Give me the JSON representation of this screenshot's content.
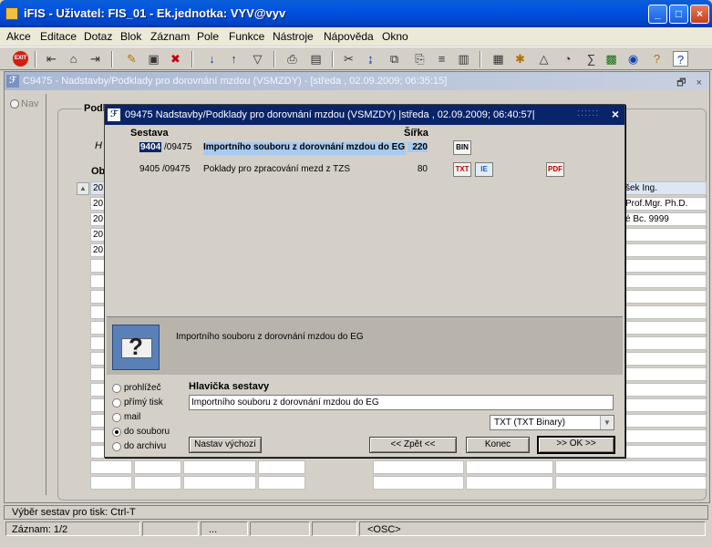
{
  "app": {
    "title": "iFIS - Uživatel: FIS_01 - Ek.jednotka: VYV@vyv",
    "window_buttons": [
      "_",
      "□",
      "×"
    ]
  },
  "menu": [
    "Akce",
    "Editace",
    "Dotaz",
    "Blok",
    "Záznam",
    "Pole",
    "Funkce",
    "Nástroje",
    "Nápověda",
    "Okno"
  ],
  "toolbar": {
    "exit_label": "EXIT",
    "icons": [
      "exit-icon",
      "save-icon",
      "cancel-icon",
      "print-preview-icon",
      "print-icon",
      "delete-icon",
      "sort-asc-icon",
      "sort-desc-icon",
      "filter-icon",
      "print-setup-icon",
      "document-icon",
      "cut-icon",
      "arrow-icon",
      "copy-icon",
      "paste-icon",
      "list-icon",
      "column-icon",
      "calc-icon",
      "settings-icon",
      "warning-icon",
      "clock-icon",
      "sum-icon",
      "excel-icon",
      "word-icon",
      "help-icon",
      "question-icon"
    ]
  },
  "mdi": {
    "title": "C9475 - Nadstavby/Podklady pro dorovnání mzdou (VSMZDY) - [středa , 02.09.2009; 06:35:15]",
    "controls": "🗗 ×",
    "nav_label": "Nav",
    "group_label": "Podk",
    "tab_fragment": "H",
    "col_fragment": "Ob",
    "left_cells": [
      "20",
      "20",
      "20",
      "20",
      "20"
    ],
    "right_cells": [
      "šek Ing.",
      "Prof.Mgr. Ph.D.",
      "é Bc. 9999"
    ]
  },
  "dialog": {
    "title": "09475   Nadstavby/Podklady pro dorovnání mzdou (VSMZDY)   |středa , 02.09.2009; 06:40:57|",
    "title_dots": "::::::",
    "close": "×",
    "col_report": "Sestava",
    "col_width": "Šířka",
    "rows": [
      {
        "code_hl": "9404",
        "code_rest": " /09475",
        "name": "Importního souboru z dorovnání mzdou do EG",
        "width": "220",
        "formats": [
          "BIN"
        ]
      },
      {
        "code_hl": "",
        "code_rest": "9405 /09475",
        "name": "Poklady pro zpracování mezd z TZS",
        "width": "80",
        "formats": [
          "TXT",
          "IE",
          "PDF"
        ]
      }
    ],
    "description": "Importního souboru z dorovnání mzdou do EG",
    "outputs": [
      {
        "label": "prohlížeč",
        "checked": false
      },
      {
        "label": "přímý tisk",
        "checked": false
      },
      {
        "label": "mail",
        "checked": false
      },
      {
        "label": "do souboru",
        "checked": true
      },
      {
        "label": "do archivu",
        "checked": false
      }
    ],
    "header_label": "Hlavička sestavy",
    "header_value": "Importního souboru z dorovnání mzdou do EG",
    "format_value": "TXT (TXT Binary)",
    "buttons": {
      "defaults": "Nastav výchozí",
      "back": "<< Zpět <<",
      "end": "Konec",
      "ok": ">> OK >>"
    }
  },
  "status": {
    "hint": "Výběr sestav pro tisk: Ctrl-T",
    "record": "Záznam: 1/2",
    "ellipsis": "...",
    "osc": "<OSC>"
  }
}
